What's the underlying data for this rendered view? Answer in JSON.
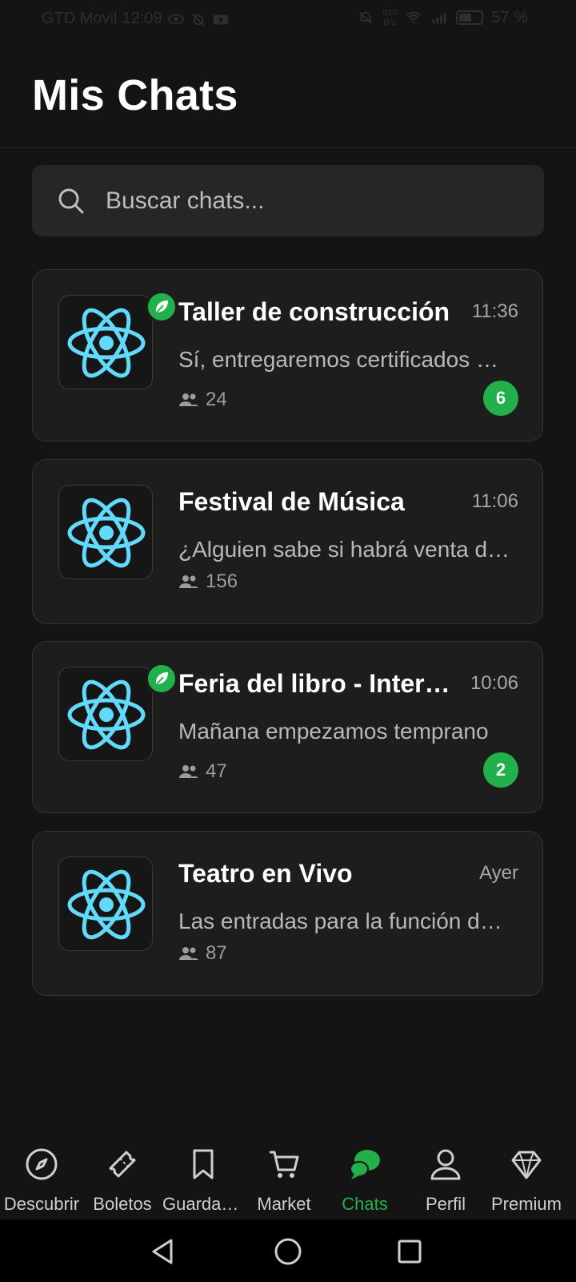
{
  "status_bar": {
    "carrier": "GTD Movil",
    "time": "12:09",
    "net_speed_value": "830",
    "net_speed_unit": "B/s",
    "battery": "57 %",
    "battery_level": 0.57
  },
  "header": {
    "title": "Mis Chats"
  },
  "search": {
    "placeholder": "Buscar chats..."
  },
  "chats": [
    {
      "name": "Taller de construcción",
      "time": "11:36",
      "message": "Sí, entregaremos certificados de participación",
      "members": "24",
      "unread": "6",
      "has_leaf": true
    },
    {
      "name": "Festival de Música",
      "time": "11:06",
      "message": "¿Alguien sabe si habrá venta de comida?",
      "members": "156",
      "unread": "",
      "has_leaf": false
    },
    {
      "name": "Feria del libro - Internacional",
      "time": "10:06",
      "message": "Mañana empezamos temprano",
      "members": "47",
      "unread": "2",
      "has_leaf": true
    },
    {
      "name": "Teatro en Vivo",
      "time": "Ayer",
      "message": "Las entradas para la función de hoy",
      "members": "87",
      "unread": "",
      "has_leaf": false
    }
  ],
  "bottom_nav": [
    {
      "label": "Descubrir",
      "icon": "compass-icon"
    },
    {
      "label": "Boletos",
      "icon": "ticket-icon"
    },
    {
      "label": "Guardados",
      "icon": "bookmark-icon"
    },
    {
      "label": "Market",
      "icon": "cart-icon"
    },
    {
      "label": "Chats",
      "icon": "chat-bubbles-icon",
      "active": true
    },
    {
      "label": "Perfil",
      "icon": "user-icon"
    },
    {
      "label": "Premium",
      "icon": "diamond-icon"
    }
  ],
  "colors": {
    "accent": "#22b04b",
    "background": "#141414",
    "card": "#1d1d1d",
    "react_blue": "#61dafb"
  }
}
